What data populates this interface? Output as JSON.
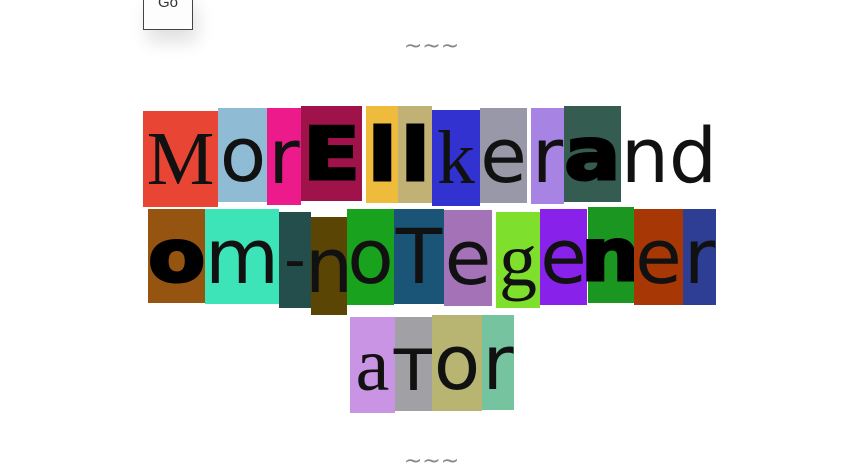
{
  "controls": {
    "go_label": "Go"
  },
  "dividers": {
    "top": "~~~",
    "bottom": "~~~"
  },
  "ransom_text": {
    "lines": [
      "MorEllkerand",
      "om-noTegener",
      "ator"
    ],
    "tiles": [
      {
        "ch": "M",
        "bg": "#e94535",
        "fg": "#111111",
        "font": "serif"
      },
      {
        "ch": "o",
        "bg": "#8fbcd4",
        "fg": "#111111",
        "font": "sans"
      },
      {
        "ch": "r",
        "bg": "#ec1a8a",
        "fg": "#111111",
        "font": "sans"
      },
      {
        "ch": "E",
        "bg": "#a0124a",
        "fg": "#000000",
        "font": "bold"
      },
      {
        "ch": "l",
        "bg": "#eebb3d",
        "fg": "#000000",
        "font": "bold"
      },
      {
        "ch": "l",
        "bg": "#c2b175",
        "fg": "#000000",
        "font": "bold"
      },
      {
        "ch": "k",
        "bg": "#3232d0",
        "fg": "#111111",
        "font": "serif"
      },
      {
        "ch": "e",
        "bg": "#9898a8",
        "fg": "#111111",
        "font": "sans"
      },
      {
        "ch": "r",
        "bg": "#a784e4",
        "fg": "#111111",
        "font": "sans"
      },
      {
        "ch": "a",
        "bg": "#355c50",
        "fg": "#000000",
        "font": "bold"
      },
      {
        "ch": "n",
        "bg": "#ffffff",
        "fg": "#111111",
        "font": "sans"
      },
      {
        "ch": "d",
        "bg": "#ffffff",
        "fg": "#111111",
        "font": "sans"
      },
      {
        "ch": "o",
        "bg": "#955511",
        "fg": "#000000",
        "font": "bold"
      },
      {
        "ch": "m",
        "bg": "#3de4b8",
        "fg": "#111111",
        "font": "sans"
      },
      {
        "ch": "-",
        "bg": "#234e4c",
        "fg": "#111111",
        "font": "sans"
      },
      {
        "ch": "n",
        "bg": "#5b4505",
        "fg": "#111111",
        "font": "sans"
      },
      {
        "ch": "o",
        "bg": "#19a21d",
        "fg": "#111111",
        "font": "sans"
      },
      {
        "ch": "T",
        "bg": "#1a5578",
        "fg": "#111111",
        "font": "sans"
      },
      {
        "ch": "e",
        "bg": "#a473b7",
        "fg": "#111111",
        "font": "sans"
      },
      {
        "ch": "g",
        "bg": "#7ee02d",
        "fg": "#111111",
        "font": "serif"
      },
      {
        "ch": "e",
        "bg": "#8821ea",
        "fg": "#111111",
        "font": "sans"
      },
      {
        "ch": "n",
        "bg": "#1b9621",
        "fg": "#000000",
        "font": "bold"
      },
      {
        "ch": "e",
        "bg": "#a73806",
        "fg": "#111111",
        "font": "sans"
      },
      {
        "ch": "r",
        "bg": "#2e3e94",
        "fg": "#111111",
        "font": "sans"
      },
      {
        "ch": "a",
        "bg": "#c994e4",
        "fg": "#111111",
        "font": "serif"
      },
      {
        "ch": "т",
        "bg": "#a1a0a5",
        "fg": "#111111",
        "font": "sans"
      },
      {
        "ch": "o",
        "bg": "#b8b471",
        "fg": "#111111",
        "font": "sans"
      },
      {
        "ch": "r",
        "bg": "#76c39f",
        "fg": "#111111",
        "font": "sans"
      }
    ]
  }
}
